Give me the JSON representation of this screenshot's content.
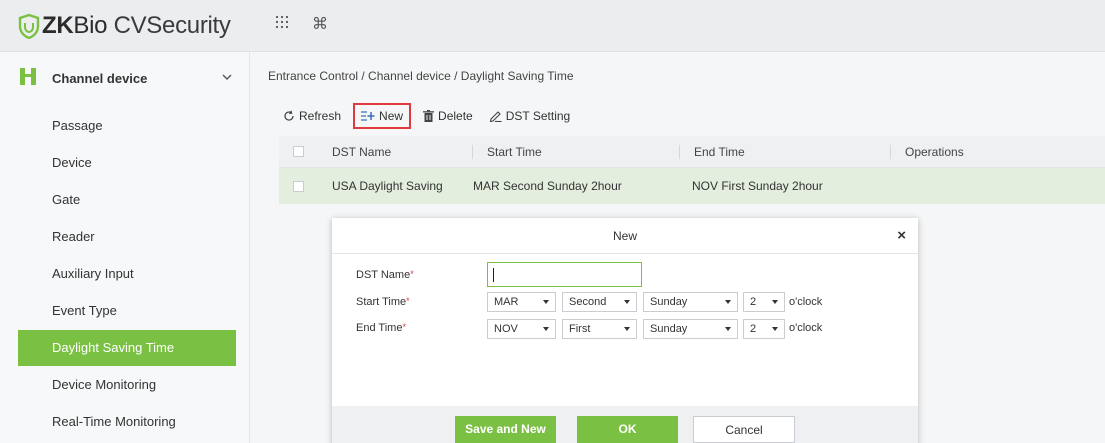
{
  "app": {
    "brand_icon": "shield-icon",
    "brand_zk": "ZK",
    "brand_bio": "Bio",
    "brand_cv": " CVSecurity"
  },
  "topbar": {
    "icons": [
      "apps-grid-icon",
      "command-icon"
    ]
  },
  "sidebar": {
    "header": {
      "label": "Channel device",
      "icon": "gate-icon"
    },
    "items": [
      {
        "label": "Passage"
      },
      {
        "label": "Device"
      },
      {
        "label": "Gate"
      },
      {
        "label": "Reader"
      },
      {
        "label": "Auxiliary Input"
      },
      {
        "label": "Event Type"
      },
      {
        "label": "Daylight Saving Time",
        "active": true
      },
      {
        "label": "Device Monitoring"
      },
      {
        "label": "Real-Time Monitoring"
      }
    ]
  },
  "breadcrumb": "Entrance Control / Channel device / Daylight Saving Time",
  "toolbar": {
    "refresh": "Refresh",
    "new": "New",
    "delete": "Delete",
    "dst_setting": "DST Setting"
  },
  "table": {
    "columns": [
      "DST Name",
      "Start Time",
      "End Time",
      "Operations"
    ],
    "rows": [
      {
        "name": "USA Daylight Saving",
        "start": "MAR Second Sunday 2hour",
        "end": "NOV First Sunday 2hour",
        "ops": ""
      }
    ]
  },
  "modal": {
    "title": "New",
    "close": "×",
    "fields": {
      "dst_name": {
        "label": "DST Name",
        "required": "*",
        "value": ""
      },
      "start_time": {
        "label": "Start Time",
        "required": "*",
        "month": "MAR",
        "week": "Second",
        "day": "Sunday",
        "hour": "2",
        "unit": "o'clock"
      },
      "end_time": {
        "label": "End Time",
        "required": "*",
        "month": "NOV",
        "week": "First",
        "day": "Sunday",
        "hour": "2",
        "unit": "o'clock"
      }
    },
    "buttons": {
      "save_new": "Save and New",
      "ok": "OK",
      "cancel": "Cancel"
    }
  },
  "colors": {
    "accent": "#7ac143",
    "highlight": "#e0393e"
  }
}
